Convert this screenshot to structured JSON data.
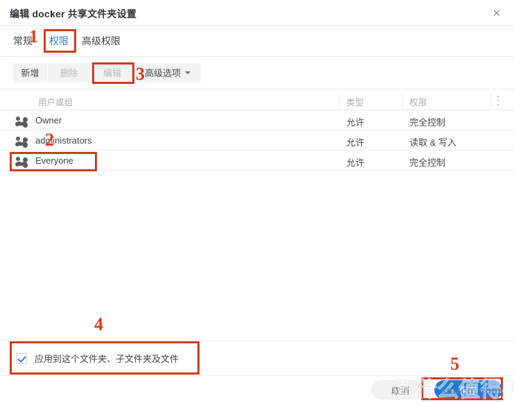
{
  "window": {
    "title": "编辑 docker 共享文件夹设置",
    "close_icon": "close-icon"
  },
  "tabs": [
    {
      "label": "常规",
      "active": false
    },
    {
      "label": "权限",
      "active": true
    },
    {
      "label": "高级权限",
      "active": false
    }
  ],
  "toolbar": [
    {
      "label": "新增",
      "disabled": false
    },
    {
      "label": "删除",
      "disabled": true
    },
    {
      "label": "编辑",
      "disabled": true
    },
    {
      "label": "高级选项",
      "disabled": false,
      "has_caret": true
    }
  ],
  "table": {
    "columns": [
      "用户或组",
      "类型",
      "权限"
    ],
    "menu_icon": "kebab-menu-icon",
    "rows": [
      {
        "icon": "group-icon",
        "user": "Owner",
        "type": "允许",
        "permission": "完全控制"
      },
      {
        "icon": "group-icon",
        "user": "administrators",
        "type": "允许",
        "permission": "读取 & 写入"
      },
      {
        "icon": "group-icon",
        "user": "Everyone",
        "type": "允许",
        "permission": "完全控制"
      }
    ]
  },
  "apply": {
    "checked": true,
    "label": "应用到这个文件夹、子文件夹及文件"
  },
  "footer": {
    "cancel_label": "取消",
    "save_label": "保存"
  },
  "annotations": {
    "numbers": [
      "1",
      "2",
      "3",
      "4",
      "5"
    ],
    "color": "#e03a16",
    "box_color": "#cf3a20"
  },
  "watermark": {
    "main": "什么值得买",
    "mark": "值",
    "sub": "smzdm.com"
  }
}
